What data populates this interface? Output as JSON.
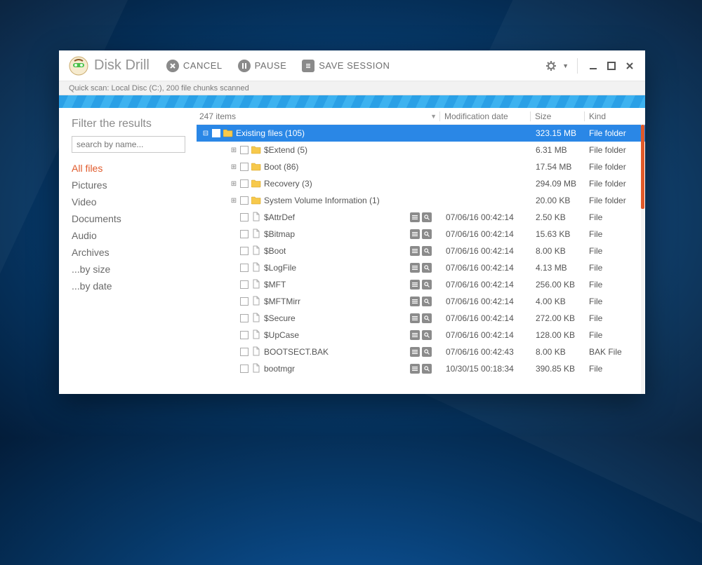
{
  "app": {
    "title": "Disk Drill"
  },
  "toolbar": {
    "cancel": "CANCEL",
    "pause": "PAUSE",
    "save_session": "SAVE SESSION"
  },
  "status": "Quick scan: Local Disc (C:), 200 file chunks scanned",
  "sidebar": {
    "title": "Filter the results",
    "search_placeholder": "search by name...",
    "items": [
      {
        "label": "All files",
        "active": true
      },
      {
        "label": "Pictures"
      },
      {
        "label": "Video"
      },
      {
        "label": "Documents"
      },
      {
        "label": "Audio"
      },
      {
        "label": "Archives"
      },
      {
        "label": "...by size"
      },
      {
        "label": "...by date"
      }
    ]
  },
  "columns": {
    "count_label": "247 items",
    "mod": "Modification date",
    "size": "Size",
    "kind": "Kind"
  },
  "rows": [
    {
      "depth": 0,
      "expander": "-",
      "icon": "folder",
      "name": "Existing files (105)",
      "mod": "",
      "size": "323.15 MB",
      "kind": "File folder",
      "selected": true
    },
    {
      "depth": 1,
      "expander": "+",
      "icon": "folder",
      "name": "$Extend (5)",
      "mod": "",
      "size": "6.31 MB",
      "kind": "File folder"
    },
    {
      "depth": 1,
      "expander": "+",
      "icon": "folder",
      "name": "Boot (86)",
      "mod": "",
      "size": "17.54 MB",
      "kind": "File folder"
    },
    {
      "depth": 1,
      "expander": "+",
      "icon": "folder",
      "name": "Recovery (3)",
      "mod": "",
      "size": "294.09 MB",
      "kind": "File folder"
    },
    {
      "depth": 1,
      "expander": "+",
      "icon": "folder",
      "name": "System Volume Information (1)",
      "mod": "",
      "size": "20.00 KB",
      "kind": "File folder"
    },
    {
      "depth": 1,
      "expander": "",
      "icon": "file",
      "name": "$AttrDef",
      "actions": true,
      "mod": "07/06/16 00:42:14",
      "size": "2.50 KB",
      "kind": "File"
    },
    {
      "depth": 1,
      "expander": "",
      "icon": "file",
      "name": "$Bitmap",
      "actions": true,
      "mod": "07/06/16 00:42:14",
      "size": "15.63 KB",
      "kind": "File"
    },
    {
      "depth": 1,
      "expander": "",
      "icon": "file",
      "name": "$Boot",
      "actions": true,
      "mod": "07/06/16 00:42:14",
      "size": "8.00 KB",
      "kind": "File"
    },
    {
      "depth": 1,
      "expander": "",
      "icon": "file",
      "name": "$LogFile",
      "actions": true,
      "mod": "07/06/16 00:42:14",
      "size": "4.13 MB",
      "kind": "File"
    },
    {
      "depth": 1,
      "expander": "",
      "icon": "file",
      "name": "$MFT",
      "actions": true,
      "mod": "07/06/16 00:42:14",
      "size": "256.00 KB",
      "kind": "File"
    },
    {
      "depth": 1,
      "expander": "",
      "icon": "file",
      "name": "$MFTMirr",
      "actions": true,
      "mod": "07/06/16 00:42:14",
      "size": "4.00 KB",
      "kind": "File"
    },
    {
      "depth": 1,
      "expander": "",
      "icon": "file",
      "name": "$Secure",
      "actions": true,
      "mod": "07/06/16 00:42:14",
      "size": "272.00 KB",
      "kind": "File"
    },
    {
      "depth": 1,
      "expander": "",
      "icon": "file",
      "name": "$UpCase",
      "actions": true,
      "mod": "07/06/16 00:42:14",
      "size": "128.00 KB",
      "kind": "File"
    },
    {
      "depth": 1,
      "expander": "",
      "icon": "file",
      "name": "BOOTSECT.BAK",
      "actions": true,
      "mod": "07/06/16 00:42:43",
      "size": "8.00 KB",
      "kind": "BAK File"
    },
    {
      "depth": 1,
      "expander": "",
      "icon": "file",
      "name": "bootmgr",
      "actions": true,
      "mod": "10/30/15 00:18:34",
      "size": "390.85 KB",
      "kind": "File"
    }
  ]
}
